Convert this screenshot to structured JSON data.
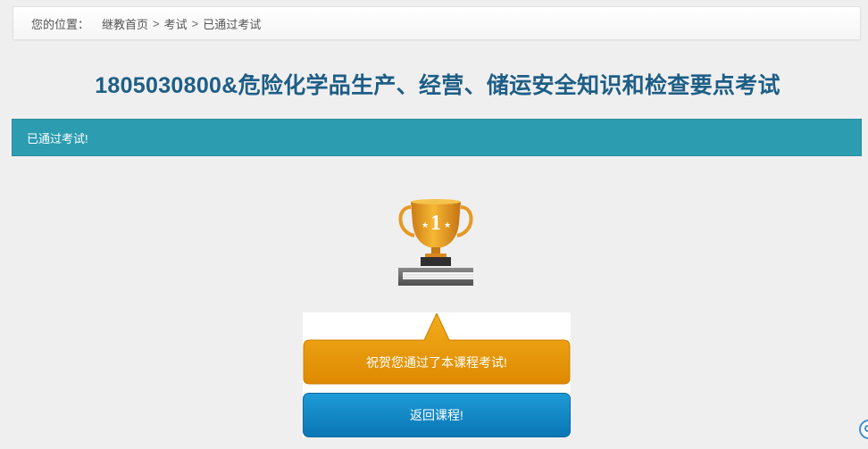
{
  "breadcrumb": {
    "label": "您的位置：",
    "items": [
      "继教首页",
      "考试",
      "已通过考试"
    ],
    "separator": ">"
  },
  "page_title": "1805030800&危险化学品生产、经营、储运安全知识和检查要点考试",
  "status_message": "已通过考试!",
  "trophy": {
    "rank": "1",
    "icon": "trophy-icon"
  },
  "congrats_message": "祝贺您通过了本课程考试!",
  "back_button_label": "返回课程!",
  "colors": {
    "title": "#1d5e86",
    "status_bar": "#2c9cb1",
    "congrats": "#ec9b00",
    "back_button": "#0f84c4",
    "background": "#f0eff0"
  }
}
